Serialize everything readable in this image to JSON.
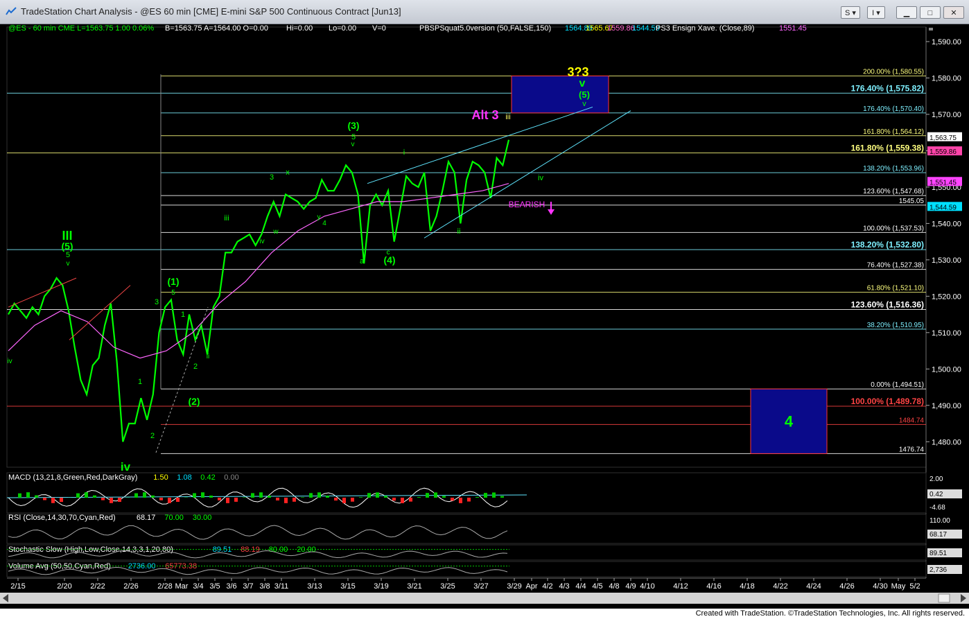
{
  "window": {
    "title": "TradeStation Chart Analysis - @ES 60 min [CME] E-mini S&P 500 Continuous Contract [Jun13]",
    "buttons": {
      "s": "S",
      "i": "I"
    }
  },
  "footer": {
    "credit": "Created with TradeStation. ©TradeStation Technologies, Inc. All rights reserved."
  },
  "header_texts": [
    {
      "t": "@ES - 60 min  CME  L=1563.75  1.00  0.06%",
      "c": "#00ff00"
    },
    {
      "t": "B=1563.75  A=1564.00  O=0.00",
      "c": "#ffffff"
    },
    {
      "t": "Hi=0.00",
      "c": "#ffffff"
    },
    {
      "t": "Lo=0.00",
      "c": "#ffffff"
    },
    {
      "t": "V=0",
      "c": "#ffffff"
    },
    {
      "t": "PBSPSquat5.0version (50,FALSE,150)",
      "c": "#ffffff"
    },
    {
      "t": "1564.89",
      "c": "#00e0ff"
    },
    {
      "t": "1565.67",
      "c": "#ffff00"
    },
    {
      "t": "1559.86",
      "c": "#ff66cc"
    },
    {
      "t": "1544.59",
      "c": "#00e0ff"
    },
    {
      "t": "PS3 Ensign Xave. (Close,89)",
      "c": "#ffffff"
    },
    {
      "t": "1551.45",
      "c": "#ff66ff"
    }
  ],
  "chart_data": {
    "type": "line",
    "title": "@ES 60 min [CME] E-mini S&P 500 Continuous Contract [Jun13]",
    "ylim": [
      1473,
      1594
    ],
    "y_ticks": [
      "1,480.00",
      "1,490.00",
      "1,500.00",
      "1,510.00",
      "1,520.00",
      "1,530.00",
      "1,540.00",
      "1,550.00",
      "1,560.00",
      "1,570.00",
      "1,580.00",
      "1,590.00"
    ],
    "x_ticks": [
      "2/15",
      "2/20",
      "2/22",
      "2/26",
      "2/28",
      "Mar",
      "3/4",
      "3/5",
      "3/6",
      "3/7",
      "3/8",
      "3/11",
      "3/13",
      "3/15",
      "3/19",
      "3/21",
      "3/25",
      "3/27",
      "3/29",
      "Apr",
      "4/2",
      "4/3",
      "4/4",
      "4/5",
      "4/8",
      "4/9",
      "4/10",
      "4/12",
      "4/16",
      "4/18",
      "4/22",
      "4/24",
      "4/26",
      "4/30",
      "May",
      "5/2"
    ],
    "price_series": {
      "name": "@ES - 60 min",
      "color": "#00ff00",
      "values": [
        1515,
        1518,
        1516,
        1514,
        1517,
        1515,
        1520,
        1522,
        1525,
        1523,
        1516,
        1506,
        1497,
        1493,
        1501,
        1503,
        1512,
        1518,
        1502,
        1480,
        1485,
        1485,
        1492,
        1486,
        1493,
        1510,
        1517,
        1519,
        1508,
        1504,
        1515,
        1508,
        1512,
        1504,
        1517,
        1520,
        1532,
        1532,
        1535,
        1536,
        1537,
        1534,
        1537,
        1542,
        1546,
        1542,
        1548,
        1547,
        1546,
        1544,
        1546,
        1547,
        1552,
        1549,
        1549,
        1552,
        1556,
        1554,
        1548,
        1529,
        1545,
        1548,
        1545,
        1549,
        1535,
        1544,
        1553,
        1551,
        1550,
        1554,
        1538,
        1542,
        1549,
        1557,
        1554,
        1540,
        1552,
        1557,
        1556,
        1554,
        1547,
        1558,
        1556,
        1563
      ]
    },
    "ema_series": {
      "name": "PS3 Ensign Xave. (Close,89)",
      "color": "#ff66ff",
      "values": [
        1505,
        1512,
        1516,
        1513,
        1506,
        1503,
        1505,
        1510,
        1518,
        1524,
        1532,
        1538,
        1542,
        1544,
        1546,
        1546,
        1547,
        1548,
        1549,
        1551
      ]
    },
    "fib_levels": [
      {
        "label": "200.00% (1,580.55)",
        "value": 1580.55,
        "color": "#ffff80",
        "big": false
      },
      {
        "label": "176.40% (1,575.82)",
        "value": 1575.82,
        "color": "#7ff0ff",
        "big": true
      },
      {
        "label": "176.40% (1,570.40)",
        "value": 1570.4,
        "color": "#7ff0ff",
        "big": false
      },
      {
        "label": "161.80% (1,564.12)",
        "value": 1564.12,
        "color": "#ffff80",
        "big": false
      },
      {
        "label": "161.80% (1,559.38)",
        "value": 1559.38,
        "color": "#ffff80",
        "big": true
      },
      {
        "label": "138.20% (1,553.96)",
        "value": 1553.96,
        "color": "#7ff0ff",
        "big": false
      },
      {
        "label": "123.60% (1,547.68)",
        "value": 1547.68,
        "color": "#ffffff",
        "big": false
      },
      {
        "label": "1545.05",
        "value": 1545.05,
        "color": "#ffffff",
        "big": false
      },
      {
        "label": "100.00% (1,537.53)",
        "value": 1537.53,
        "color": "#ffffff",
        "big": false
      },
      {
        "label": "138.20% (1,532.80)",
        "value": 1532.8,
        "color": "#7ff0ff",
        "big": true
      },
      {
        "label": "76.40% (1,527.38)",
        "value": 1527.38,
        "color": "#ffffff",
        "big": false
      },
      {
        "label": "61.80% (1,521.10)",
        "value": 1521.1,
        "color": "#ffff80",
        "big": false
      },
      {
        "label": "123.60% (1,516.36)",
        "value": 1516.36,
        "color": "#ffffff",
        "big": true
      },
      {
        "label": "38.20% (1,510.95)",
        "value": 1510.95,
        "color": "#7ff0ff",
        "big": false
      },
      {
        "label": "0.00% (1,494.51)",
        "value": 1494.51,
        "color": "#ffffff",
        "big": false
      },
      {
        "label": "100.00% (1,489.78)",
        "value": 1489.78,
        "color": "#ff4444",
        "big": true
      },
      {
        "label": "1484.74",
        "value": 1484.74,
        "color": "#ff4444",
        "big": false
      },
      {
        "label": "1476.74",
        "value": 1476.74,
        "color": "#ffffff",
        "big": false
      }
    ],
    "price_tags": [
      {
        "text": "1,563.75",
        "value": 1563.75,
        "bg": "#ffffff",
        "fg": "#000"
      },
      {
        "text": "1,559.86",
        "value": 1559.86,
        "bg": "#ff44aa",
        "fg": "#000"
      },
      {
        "text": "1,551.45",
        "value": 1551.45,
        "bg": "#ff44ff",
        "fg": "#000"
      },
      {
        "text": "1,544.59",
        "value": 1544.59,
        "bg": "#00e0ff",
        "fg": "#000"
      }
    ],
    "target_boxes": [
      {
        "label": "",
        "y_top": 1580.55,
        "y_bottom": 1570.4,
        "x_start": "3/29",
        "x_end": "4/5"
      },
      {
        "label": "4",
        "y_top": 1494.51,
        "y_bottom": 1476.74,
        "x_start": "4/17",
        "x_end": "4/25"
      }
    ],
    "wave_labels": [
      "3?3",
      "v",
      "(5)",
      "v",
      "Alt 3",
      "iii",
      "(3)",
      "5",
      "v",
      "i",
      "iv",
      "BEARISH",
      "3",
      "x",
      "w",
      "y",
      "4",
      "iii",
      "iv",
      "ii",
      "(4)",
      "c",
      "a",
      "III",
      "(5)",
      "5",
      "v",
      "(1)",
      "5",
      "3",
      "1",
      "2",
      "ii",
      "(2)",
      "1",
      "2",
      "iv",
      "iv"
    ],
    "indicators": [
      {
        "name": "MACD",
        "header": "MACD (13,21,8,Green,Red,DarkGray)",
        "values": [
          "1.50",
          "1.08",
          "0.42",
          "0.00"
        ],
        "colors": [
          "#ffff00",
          "#00e0ff",
          "#00ff00",
          "#888888"
        ],
        "axis": [
          "2.00",
          "0.42",
          "-4.68"
        ]
      },
      {
        "name": "RSI",
        "header": "RSI (Close,14,30,70,Cyan,Red)",
        "values": [
          "68.17",
          "70.00",
          "30.00"
        ],
        "colors": [
          "#ffffff",
          "#00ff00",
          "#00ff00"
        ],
        "axis": [
          "110.00",
          "68.17"
        ]
      },
      {
        "name": "Stochastic",
        "header": "Stochastic Slow (High,Low,Close,14,3,3,1,20,80)",
        "values": [
          "89.51",
          "88.19",
          "80.00",
          "20.00"
        ],
        "colors": [
          "#00e0ff",
          "#ff4444",
          "#00ff00",
          "#00ff00"
        ],
        "axis": [
          "89.51"
        ]
      },
      {
        "name": "Volume",
        "header": "Volume Avg (50,50,Cyan,Red)",
        "values": [
          "2736.00",
          "65773.38"
        ],
        "colors": [
          "#00e0ff",
          "#ff4444"
        ],
        "axis": [
          "2,736"
        ]
      }
    ]
  }
}
